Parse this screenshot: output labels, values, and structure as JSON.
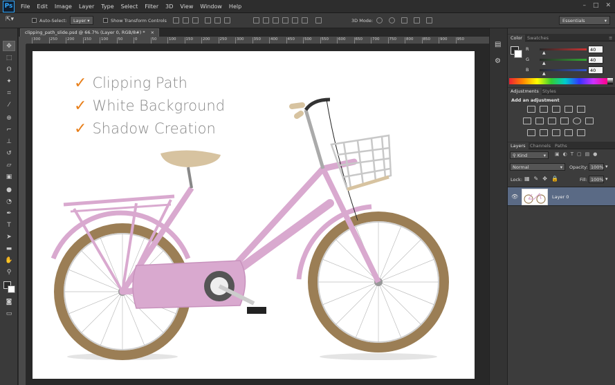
{
  "app": {
    "logo": "Ps"
  },
  "menu": [
    "File",
    "Edit",
    "Image",
    "Layer",
    "Type",
    "Select",
    "Filter",
    "3D",
    "View",
    "Window",
    "Help"
  ],
  "window_controls": [
    "–",
    "□",
    "✕"
  ],
  "options": {
    "auto_select_label": "Auto-Select:",
    "auto_select_value": "Layer",
    "show_transform_label": "Show Transform Controls",
    "mode_3d_label": "3D Mode:",
    "workspace": "Essentials"
  },
  "document": {
    "tab_title": "clipping_path_slide.psd @ 66.7% (Layer 0, RGB/8#) *",
    "tab_close": "×",
    "ruler_marks": [
      "300",
      "250",
      "200",
      "150",
      "100",
      "50",
      "0",
      "50",
      "100",
      "150",
      "200",
      "250",
      "300",
      "350",
      "400",
      "450",
      "500",
      "550",
      "600",
      "650",
      "700",
      "750",
      "800",
      "850",
      "900",
      "950"
    ]
  },
  "canvas_text": {
    "lines": [
      "Clipping Path",
      "White Background",
      "Shadow Creation"
    ],
    "check": "✓"
  },
  "color_panel": {
    "tabs": [
      "Color",
      "Swatches"
    ],
    "channels": [
      {
        "label": "R",
        "value": "40",
        "color": "#cc3333"
      },
      {
        "label": "G",
        "value": "40",
        "color": "#33aa33"
      },
      {
        "label": "B",
        "value": "40",
        "color": "#3355cc"
      }
    ]
  },
  "adjustments_panel": {
    "tabs": [
      "Adjustments",
      "Styles"
    ],
    "title": "Add an adjustment"
  },
  "layers_panel": {
    "tabs": [
      "Layers",
      "Channels",
      "Paths"
    ],
    "kind_label": "Kind",
    "blend_mode": "Normal",
    "opacity_label": "Opacity:",
    "opacity_value": "100%",
    "lock_label": "Lock:",
    "fill_label": "Fill:",
    "fill_value": "100%",
    "layer_name": "Layer 0"
  },
  "colors": {
    "accent_check": "#e87f1a",
    "bike_frame": "#d9a9cf",
    "selected_layer": "#5a6a85"
  }
}
